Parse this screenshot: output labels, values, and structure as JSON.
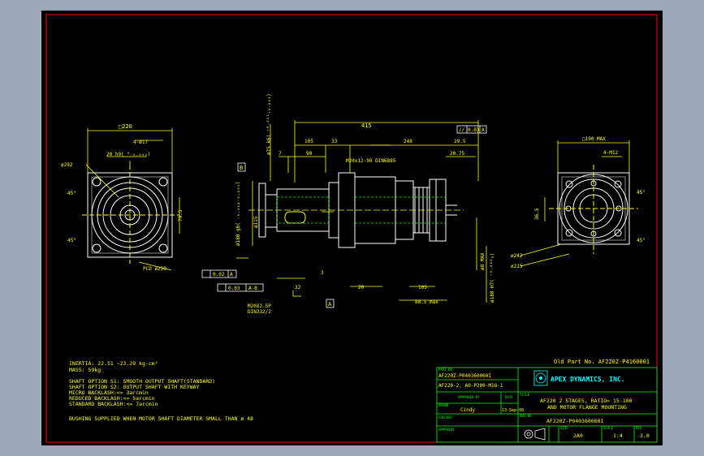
{
  "notes": {
    "inertia": "INERTIA:   22.51 ~23.29 kg-cm²",
    "mass": "MASS:  59kg",
    "line1": "SHAFT OPTION S1: SMOOTH OUTPUT SHAFT(STANDARD)",
    "line2": "SHAFT OPTION S2: OUTPUT SHAFT WITH KEYWAY",
    "line3": "MICRO BACKLASH:<= 3arcmin",
    "line4": "REDUCED BACKLASH:<= 5arcmin",
    "line5": "STANDARD BACKLASH:<= 7arcmin",
    "bushing": "BUSHING SUPPLIED WHEN MOTOR SHAFT DIAMETER SMALL THAN ø 48"
  },
  "old_part": "Old Part No. AF220Z-P4160001",
  "title_block": {
    "part_no_label": "PART NO.",
    "part_no_1": "AF220Z-P040360060I",
    "part_no_2": "AF220-2, A0-P200-M16-1",
    "approved_label": "APPROVED BY",
    "date_label": "DATE",
    "drawn_label": "DRAWN",
    "drawn_by": "Cindy",
    "drawn_date": "13-Sep-08",
    "checked_label": "CHECKED",
    "approved2_label": "APPROVED",
    "company": "APEX DYNAMICS, INC.",
    "title_label": "TITLE",
    "title_1": "AF220 2 STAGES, RATIO= 15-100",
    "title_2": "AND MOTOR FLANGE MOUNTING",
    "dwg_label": "DWG NO.",
    "dwg_no": "AF220Z-P040360060I",
    "size_label": "SIZE",
    "size": "2A0",
    "scale_label": "SCALE",
    "scale": "1:4",
    "rev_label": "REV",
    "rev": "3.0"
  },
  "dims": {
    "sq220": "□220",
    "h4_17": "4-ø17",
    "d20h9": "20 h9(  ⁰₋₀.₀₅₂)",
    "d292": "ø292",
    "a45_l1": "45°",
    "a45_l2": "45°",
    "d79_5": "79.5",
    "pcd250": "PCD ø250",
    "d75k6": "ø75 k6(  ⁺⁰·⁰²¹₊₀.₀₀₂)",
    "d415": "415",
    "d105": "105",
    "d33": "33",
    "d248": "248",
    "d29_5": "29.5",
    "d7": "7",
    "d90": "90",
    "m20": "M20x12-90 DIN6885",
    "d20_75": "20.75",
    "d180g6": "ø180 g6(  ₋₀.₀₁₄₋₀.₀₃₉)",
    "d115": "ø115",
    "d3": "3",
    "d32": "32",
    "d20": "20",
    "d105b": "105",
    "d88": "ø8 MAX",
    "d180h7": "ø180 H7(  ⁺⁰·⁰⁴⁰₀)",
    "d885": "88.5 max",
    "m20x2": "M20X2.5P",
    "din332": "DIN332/2",
    "tol1_sym": "//",
    "tol1_val": "0.03",
    "tol1_ref": "A",
    "tol2_val": "0.02",
    "tol2_ref": "A",
    "tol3_val": "0.03",
    "tol3_ref": "A-B",
    "datum_b": "B",
    "datum_a": "A",
    "sq190": "□190 MAX",
    "h4m12": "4-M12",
    "d36_5": "36.5",
    "a45_r1": "45°",
    "a45_r2": "45°",
    "d242": "ø242",
    "d215": "ø215"
  }
}
